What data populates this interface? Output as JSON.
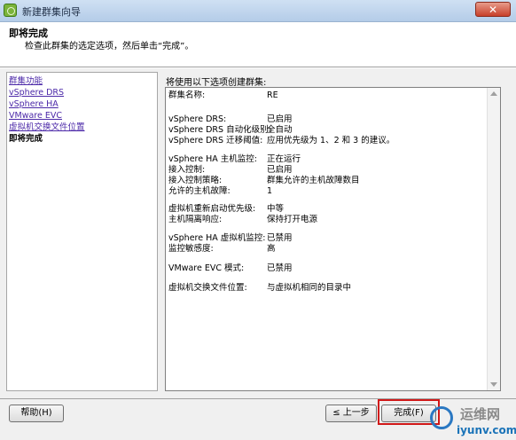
{
  "window": {
    "title": "新建群集向导",
    "close_glyph": "✕"
  },
  "header": {
    "title": "即将完成",
    "subtitle": "检查此群集的选定选项，然后单击“完成”。"
  },
  "nav": {
    "items": [
      {
        "label": "群集功能",
        "state": "link"
      },
      {
        "label": "vSphere DRS",
        "state": "link"
      },
      {
        "label": "vSphere HA",
        "state": "link"
      },
      {
        "label": "VMware EVC",
        "state": "link"
      },
      {
        "label": "虚拟机交换文件位置",
        "state": "link"
      },
      {
        "label": "即将完成",
        "state": "current"
      }
    ]
  },
  "summary": {
    "heading": "将使用以下选项创建群集:",
    "rows": [
      {
        "label": "群集名称:",
        "value": "RE"
      },
      {
        "label": "vSphere DRS:",
        "value": "已启用"
      },
      {
        "label": "vSphere DRS 自动化级别:",
        "value": "全自动"
      },
      {
        "label": "vSphere DRS 迁移阈值:",
        "value": "应用优先级为 1、2 和 3 的建议。"
      },
      {
        "label": "vSphere HA 主机监控:",
        "value": "正在运行"
      },
      {
        "label": "接入控制:",
        "value": "已启用"
      },
      {
        "label": "接入控制策略:",
        "value": "群集允许的主机故障数目"
      },
      {
        "label": "允许的主机故障:",
        "value": "1"
      },
      {
        "label": "虚拟机重新启动优先级:",
        "value": "中等"
      },
      {
        "label": "主机隔离响应:",
        "value": "保持打开电源"
      },
      {
        "label": "vSphere HA 虚拟机监控:",
        "value": "已禁用"
      },
      {
        "label": "监控敏感度:",
        "value": "高"
      },
      {
        "label": "VMware EVC 模式:",
        "value": "已禁用"
      },
      {
        "label": "虚拟机交换文件位置:",
        "value": "与虚拟机相同的目录中"
      }
    ]
  },
  "footer": {
    "help": "帮助(H)",
    "back": "≤ 上一步",
    "finish": "完成(F)"
  },
  "watermark": {
    "name": "运维网",
    "url": "iyunv.com"
  },
  "colors": {
    "link": "#4b28a8",
    "highlight": "#d01818",
    "titlebar": "#cfe0f3"
  }
}
